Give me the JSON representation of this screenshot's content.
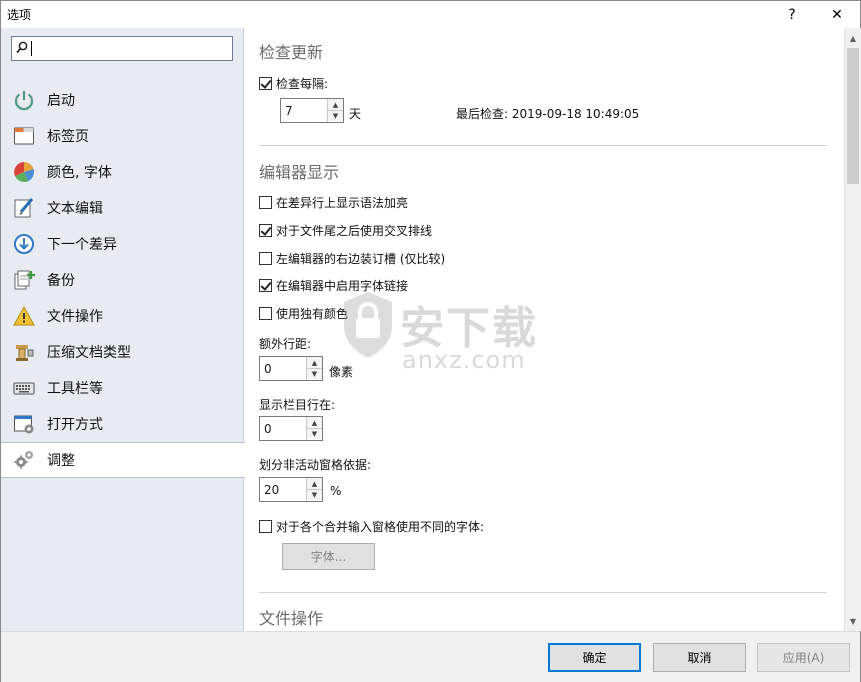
{
  "window": {
    "title": "选项",
    "help_label": "?",
    "close_label": "✕"
  },
  "sidebar": {
    "search": {
      "value": ""
    },
    "items": [
      {
        "label": "启动",
        "icon": "power-icon"
      },
      {
        "label": "标签页",
        "icon": "tab-icon"
      },
      {
        "label": "颜色, 字体",
        "icon": "color-wheel-icon"
      },
      {
        "label": "文本编辑",
        "icon": "edit-icon"
      },
      {
        "label": "下一个差异",
        "icon": "down-arrow-circle-icon"
      },
      {
        "label": "备份",
        "icon": "backup-icon"
      },
      {
        "label": "文件操作",
        "icon": "warning-icon"
      },
      {
        "label": "压缩文档类型",
        "icon": "archive-icon"
      },
      {
        "label": "工具栏等",
        "icon": "keyboard-icon"
      },
      {
        "label": "打开方式",
        "icon": "open-with-icon"
      },
      {
        "label": "调整",
        "icon": "gears-icon",
        "selected": true
      }
    ]
  },
  "content": {
    "check_updates": {
      "title": "检查更新",
      "check_every_label": "检查每隔:",
      "check_every_checked": true,
      "interval_value": "7",
      "interval_unit": "天",
      "last_check": "最后检查: 2019-09-18 10:49:05"
    },
    "editor_display": {
      "title": "编辑器显示",
      "options": [
        {
          "label": "在差异行上显示语法加亮",
          "checked": false
        },
        {
          "label": "对于文件尾之后使用交叉排线",
          "checked": true
        },
        {
          "label": "左编辑器的右边装订槽 (仅比较)",
          "checked": false
        },
        {
          "label": "在编辑器中启用字体链接",
          "checked": true
        },
        {
          "label": "使用独有颜色",
          "checked": false
        }
      ],
      "extra_spacing_label": "额外行距:",
      "extra_spacing_value": "0",
      "extra_spacing_unit": "像素",
      "column_row_label": "显示栏目行在:",
      "column_row_value": "0",
      "split_label": "划分非活动窗格依据:",
      "split_value": "20",
      "split_unit": "%",
      "diff_font_label": "对于各个合并输入窗格使用不同的字体:",
      "diff_font_checked": false,
      "font_button": "字体..."
    },
    "file_ops": {
      "title": "文件操作"
    }
  },
  "watermark": {
    "text": "安下载",
    "sub": "anxz.com"
  },
  "footer": {
    "ok": "确定",
    "cancel": "取消",
    "apply": "应用(A)"
  }
}
